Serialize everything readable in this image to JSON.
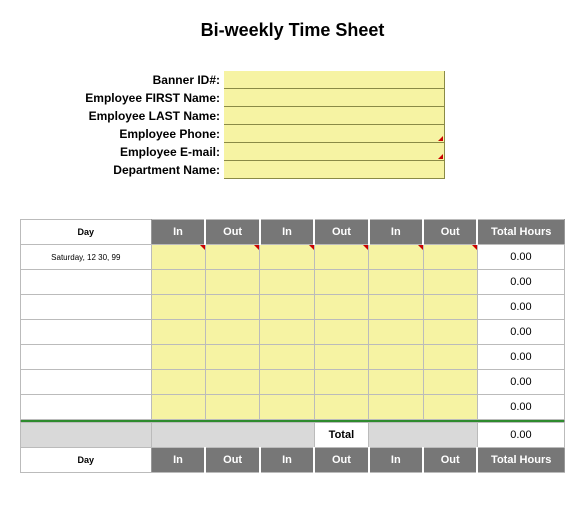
{
  "title": "Bi-weekly Time Sheet",
  "info": {
    "labels": {
      "banner": "Banner ID#:",
      "first": "Employee FIRST Name:",
      "last": "Employee LAST Name:",
      "phone": "Employee Phone:",
      "email": "Employee E-mail:",
      "dept": "Department Name:"
    },
    "values": {
      "banner": "",
      "first": "",
      "last": "",
      "phone": "",
      "email": "",
      "dept": ""
    }
  },
  "table": {
    "headers": {
      "day": "Day",
      "in": "In",
      "out": "Out",
      "total": "Total Hours"
    },
    "rows": [
      {
        "day": "Saturday, 12 30, 99",
        "in1": "",
        "out1": "",
        "in2": "",
        "out2": "",
        "in3": "",
        "out3": "",
        "total": "0.00"
      },
      {
        "day": "",
        "in1": "",
        "out1": "",
        "in2": "",
        "out2": "",
        "in3": "",
        "out3": "",
        "total": "0.00"
      },
      {
        "day": "",
        "in1": "",
        "out1": "",
        "in2": "",
        "out2": "",
        "in3": "",
        "out3": "",
        "total": "0.00"
      },
      {
        "day": "",
        "in1": "",
        "out1": "",
        "in2": "",
        "out2": "",
        "in3": "",
        "out3": "",
        "total": "0.00"
      },
      {
        "day": "",
        "in1": "",
        "out1": "",
        "in2": "",
        "out2": "",
        "in3": "",
        "out3": "",
        "total": "0.00"
      },
      {
        "day": "",
        "in1": "",
        "out1": "",
        "in2": "",
        "out2": "",
        "in3": "",
        "out3": "",
        "total": "0.00"
      },
      {
        "day": "",
        "in1": "",
        "out1": "",
        "in2": "",
        "out2": "",
        "in3": "",
        "out3": "",
        "total": "0.00"
      }
    ],
    "totalRow": {
      "label": "Total",
      "total": "0.00"
    }
  }
}
